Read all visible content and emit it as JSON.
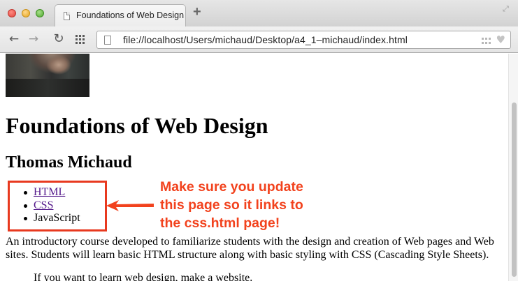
{
  "browser": {
    "tab": {
      "title": "Foundations of Web Design",
      "favicon_icon": "page-icon"
    },
    "new_tab_icon": "plus-icon",
    "fullscreen_icon": "fullscreen-arrows-icon",
    "toolbar": {
      "back_icon": "arrow-left-icon",
      "forward_icon": "arrow-right-icon",
      "reload_icon": "reload-icon",
      "apps_icon": "apps-grid-icon",
      "url": "file://localhost/Users/michaud/Desktop/a4_1–michaud/index.html",
      "omnibox_icons": [
        "page-icon",
        "grid-icon",
        "heart-icon"
      ]
    }
  },
  "page": {
    "title": "Foundations of Web Design",
    "author": "Thomas Michaud",
    "nav": [
      {
        "label": "HTML",
        "is_link": true
      },
      {
        "label": "CSS",
        "is_link": true
      },
      {
        "label": "JavaScript",
        "is_link": false
      }
    ],
    "intro": "An introductory course developed to familiarize students with the design and creation of Web pages and Web sites. Students will learn basic HTML structure along with basic styling with CSS (Cascading Style Sheets).",
    "quote": "If you want to learn web design, make a website."
  },
  "annotation": {
    "lines": [
      "Make sure you update",
      "this page so it links to",
      "the css.html page!"
    ],
    "color": "#f2421d"
  },
  "colors": {
    "link": "#551a8b",
    "annotation_border": "#e8391f",
    "tab_bg": "#d8d8d8"
  }
}
